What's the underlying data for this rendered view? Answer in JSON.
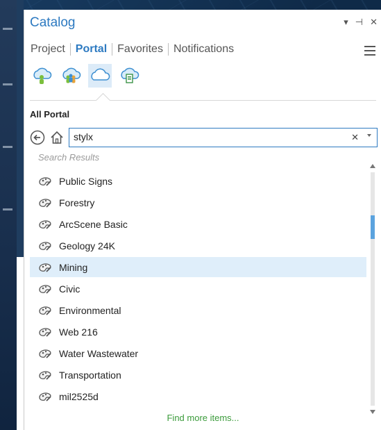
{
  "panel": {
    "title": "Catalog",
    "window_controls": {
      "menu": "▾",
      "pin": "⊣",
      "close": "✕"
    }
  },
  "tabs": [
    {
      "label": "Project",
      "active": false
    },
    {
      "label": "Portal",
      "active": true
    },
    {
      "label": "Favorites",
      "active": false
    },
    {
      "label": "Notifications",
      "active": false
    }
  ],
  "portal_icons": [
    {
      "name": "my-content-icon",
      "active": false
    },
    {
      "name": "groups-icon",
      "active": false
    },
    {
      "name": "all-portal-icon",
      "active": true
    },
    {
      "name": "living-atlas-icon",
      "active": false
    }
  ],
  "section_title": "All Portal",
  "search": {
    "value": "stylx"
  },
  "results_label": "Search Results",
  "results": [
    {
      "label": "Public Signs",
      "selected": false
    },
    {
      "label": "Forestry",
      "selected": false
    },
    {
      "label": "ArcScene Basic",
      "selected": false
    },
    {
      "label": "Geology 24K",
      "selected": false
    },
    {
      "label": "Mining",
      "selected": true
    },
    {
      "label": "Civic",
      "selected": false
    },
    {
      "label": "Environmental",
      "selected": false
    },
    {
      "label": "Web 216",
      "selected": false
    },
    {
      "label": "Water Wastewater",
      "selected": false
    },
    {
      "label": "Transportation",
      "selected": false
    },
    {
      "label": "mil2525d",
      "selected": false
    }
  ],
  "find_more": "Find more items...",
  "colors": {
    "accent": "#2d7ac1",
    "selected_row": "#dfeefa",
    "link_green": "#3b9b3b"
  }
}
